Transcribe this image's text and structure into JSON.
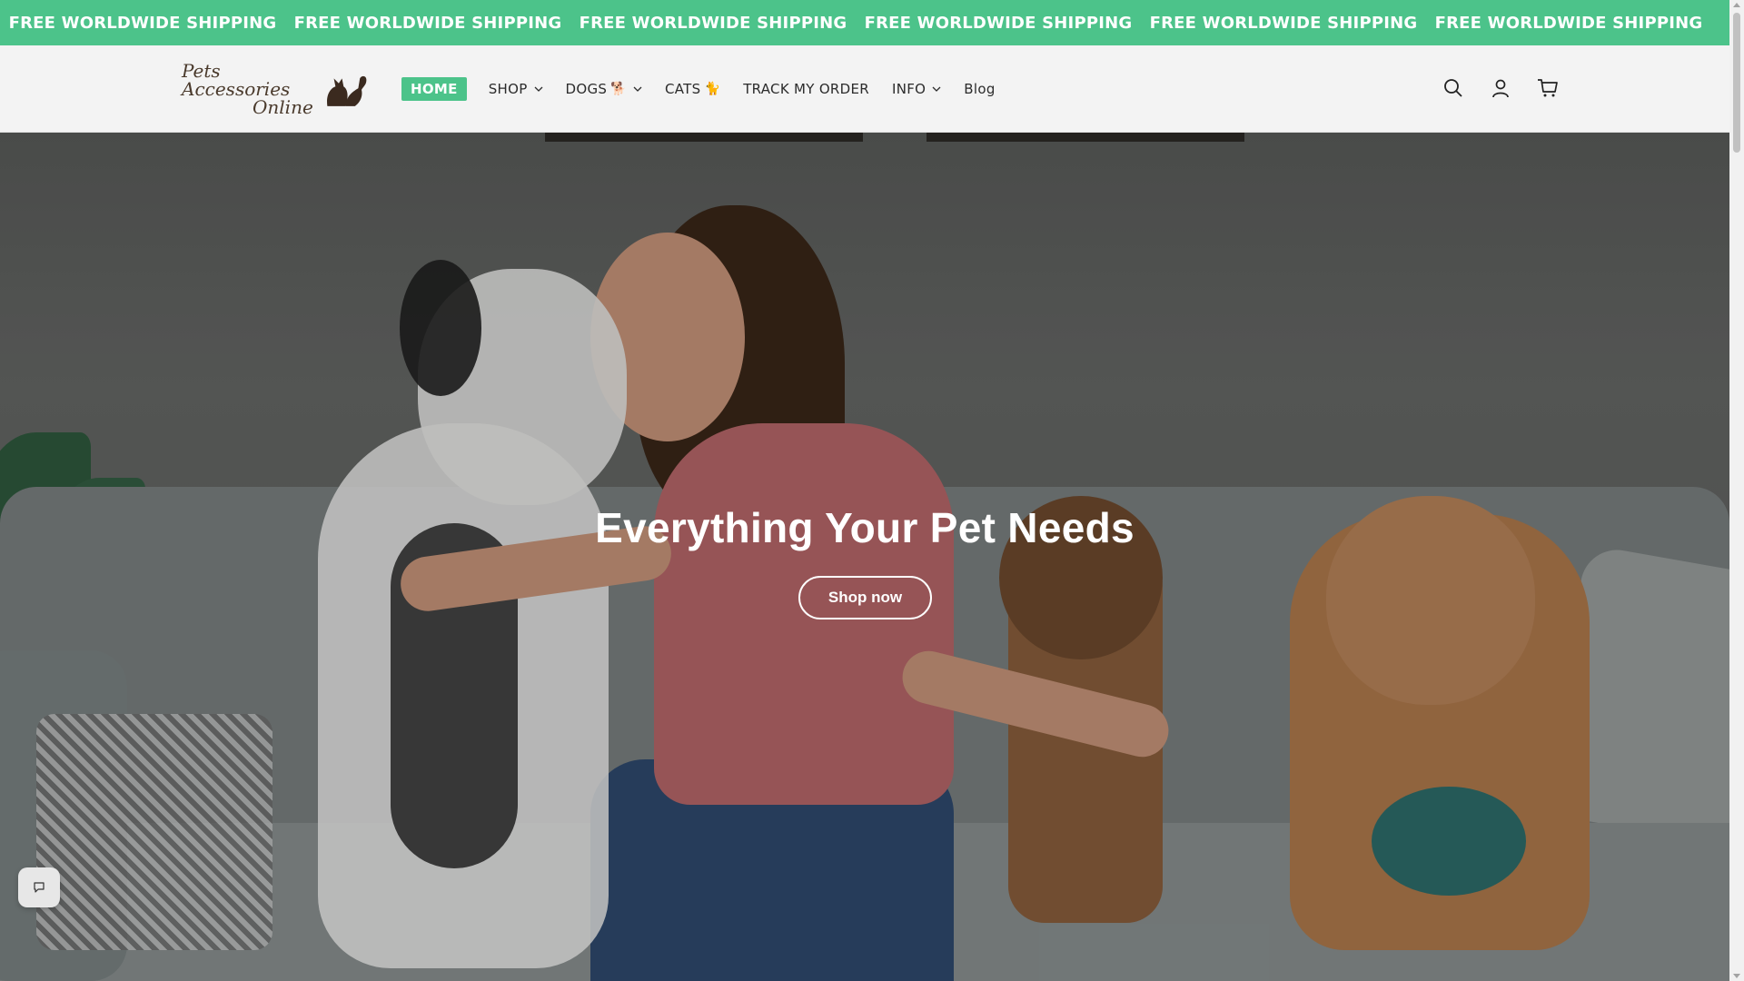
{
  "announcement": {
    "items": [
      "FREE WORLDWIDE SHIPPING",
      "FREE WORLDWIDE SHIPPING",
      "FREE WORLDWIDE SHIPPING",
      "FREE WORLDWIDE SHIPPING",
      "FREE WORLDWIDE SHIPPING",
      "FREE WORLDWIDE SHIPPING"
    ],
    "background": "#4cc38a"
  },
  "header": {
    "logo": {
      "line1": "Pets Accessories",
      "line2": "Online",
      "icon": "cat-dog-silhouette-icon"
    },
    "nav": {
      "home": "HOME",
      "shop": "SHOP",
      "dogs": "DOGS",
      "dogs_emoji": "🐕",
      "cats": "CATS",
      "cats_emoji": "🐈",
      "track": "TRACK MY ORDER",
      "info": "INFO",
      "blog": "Blog"
    },
    "icons": [
      "search-icon",
      "account-icon",
      "cart-icon"
    ]
  },
  "hero": {
    "title": "Everything Your Pet Needs",
    "button": "Shop now"
  },
  "chat": {
    "icon": "chat-bubble-icon"
  },
  "colors": {
    "accent": "#4cc38a",
    "text": "#2b2b2b"
  }
}
